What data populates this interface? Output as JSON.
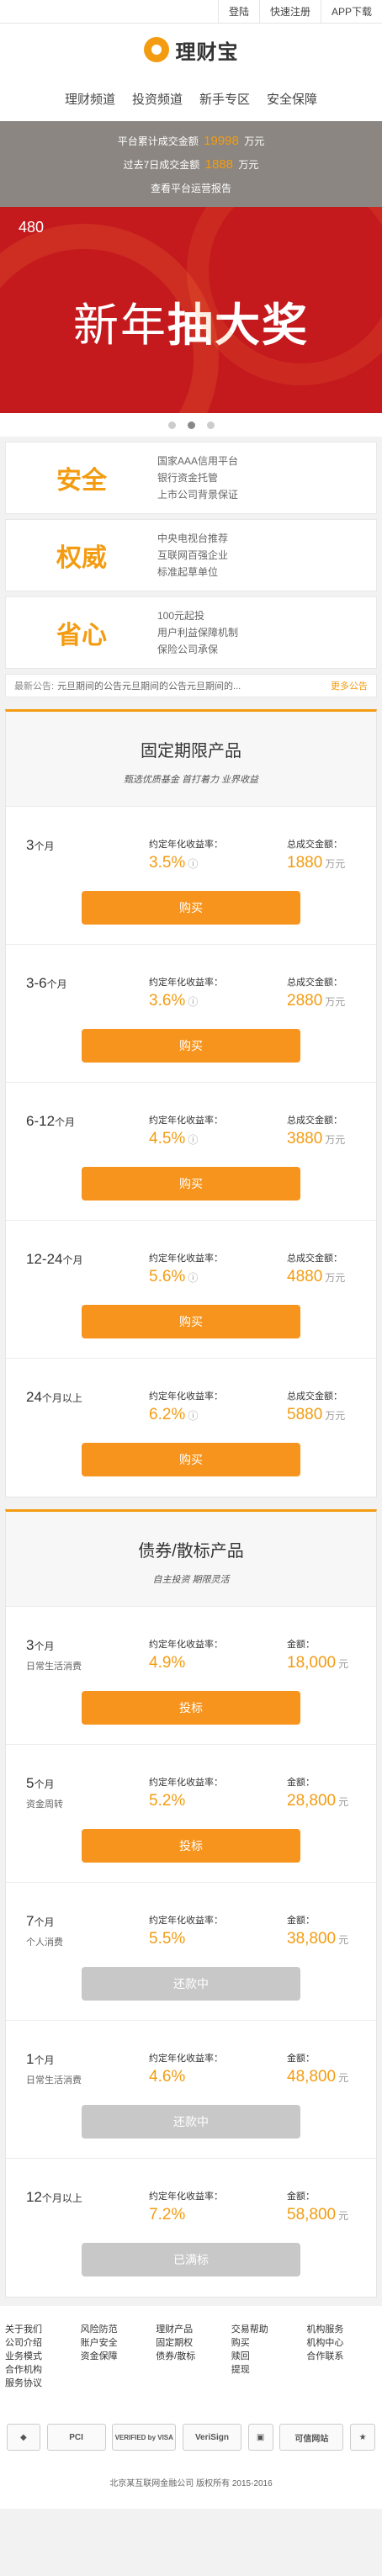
{
  "topbar": {
    "login": "登陆",
    "register": "快速注册",
    "app": "APP下载"
  },
  "logo": {
    "text": "理财宝"
  },
  "nav": [
    "理财频道",
    "投资频道",
    "新手专区",
    "安全保障"
  ],
  "stats": {
    "total_prefix": "平台累计成交金额",
    "total_value": "19998",
    "total_unit": "万元",
    "week_prefix": "过去7日成交金额",
    "week_value": "1888",
    "week_unit": "万元",
    "report": "查看平台运营报告"
  },
  "banner": {
    "tag": "480",
    "title_a": "新年",
    "title_b": "抽大奖"
  },
  "features": [
    {
      "title": "安全",
      "lines": [
        "国家AAA信用平台",
        "银行资金托管",
        "上市公司背景保证"
      ]
    },
    {
      "title": "权威",
      "lines": [
        "中央电视台推荐",
        "互联网百强企业",
        "标准起草单位"
      ]
    },
    {
      "title": "省心",
      "lines": [
        "100元起投",
        "用户利益保障机制",
        "保险公司承保"
      ]
    }
  ],
  "notice": {
    "label": "最新公告:",
    "text": "元旦期间的公告元旦期间的公告元旦期间的...",
    "more": "更多公告"
  },
  "fixed": {
    "title": "固定期限产品",
    "subtitle": "甄选优质基金  首打着力  业界收益",
    "rate_label": "约定年化收益率：",
    "amount_label": "总成交金额：",
    "items": [
      {
        "term": "3",
        "unit": "个月",
        "rate": "3.5%",
        "amount": "1880",
        "amount_unit": "万元",
        "button": "购买"
      },
      {
        "term": "3-6",
        "unit": "个月",
        "rate": "3.6%",
        "amount": "2880",
        "amount_unit": "万元",
        "button": "购买"
      },
      {
        "term": "6-12",
        "unit": "个月",
        "rate": "4.5%",
        "amount": "3880",
        "amount_unit": "万元",
        "button": "购买"
      },
      {
        "term": "12-24",
        "unit": "个月",
        "rate": "5.6%",
        "amount": "4880",
        "amount_unit": "万元",
        "button": "购买"
      },
      {
        "term": "24",
        "unit": "个月以上",
        "rate": "6.2%",
        "amount": "5880",
        "amount_unit": "万元",
        "button": "购买"
      }
    ]
  },
  "bond": {
    "title": "债券/散标产品",
    "subtitle": "自主投资  期限灵活",
    "rate_label": "约定年化收益率：",
    "amount_label": "金额：",
    "items": [
      {
        "term": "3",
        "unit": "个月",
        "desc": "日常生活消费",
        "rate": "4.9%",
        "amount": "18,000",
        "amount_unit": "元",
        "button": "投标",
        "state": "active"
      },
      {
        "term": "5",
        "unit": "个月",
        "desc": "资金周转",
        "rate": "5.2%",
        "amount": "28,800",
        "amount_unit": "元",
        "button": "投标",
        "state": "active"
      },
      {
        "term": "7",
        "unit": "个月",
        "desc": "个人消费",
        "rate": "5.5%",
        "amount": "38,800",
        "amount_unit": "元",
        "button": "还款中",
        "state": "done"
      },
      {
        "term": "1",
        "unit": "个月",
        "desc": "日常生活消费",
        "rate": "4.6%",
        "amount": "48,800",
        "amount_unit": "元",
        "button": "还款中",
        "state": "done"
      },
      {
        "term": "12",
        "unit": "个月以上",
        "desc": "",
        "rate": "7.2%",
        "amount": "58,800",
        "amount_unit": "元",
        "button": "已满标",
        "state": "done"
      }
    ]
  },
  "footer": {
    "columns": [
      [
        "关于我们",
        "公司介绍",
        "业务模式",
        "合作机构",
        "服务协议"
      ],
      [
        "风险防范",
        "账户安全",
        "资金保障"
      ],
      [
        "理财产品",
        "固定期权",
        "债券/散标"
      ],
      [
        "交易帮助",
        "购买",
        "赎回",
        "提现"
      ],
      [
        "机构服务",
        "机构中心",
        "合作联系"
      ]
    ],
    "badges": [
      "PCI",
      "VERIFIED by VISA",
      "VeriSign",
      "可信网站"
    ],
    "copyright": "北京某互联网金融公司 版权所有 2015-2016"
  }
}
